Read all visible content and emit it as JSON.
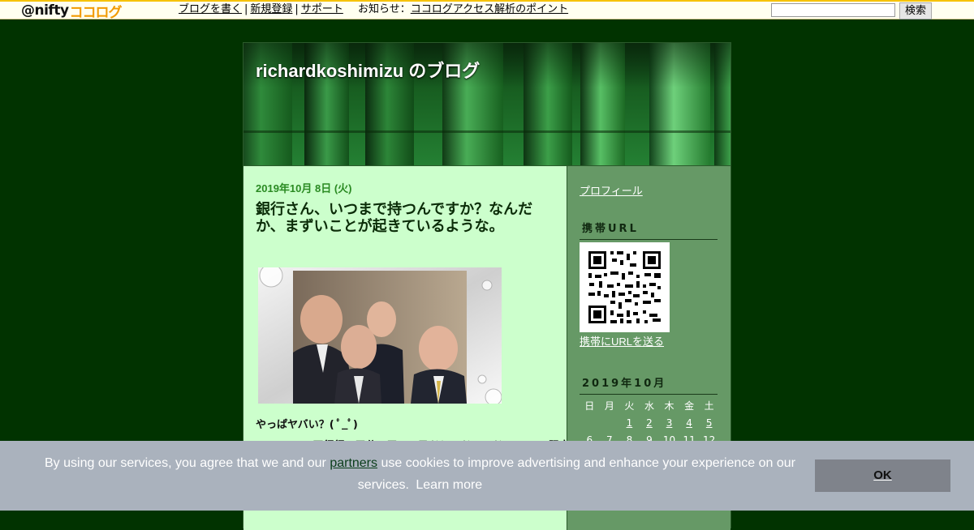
{
  "topbar": {
    "logo_at": "@nifty",
    "logo_kk": "ココログ",
    "links": [
      "ブログを書く",
      "新規登録",
      "サポート"
    ],
    "notice_label": "お知らせ",
    "notice_link": "ココログアクセス解析のポイント",
    "search_placeholder": "",
    "search_button": "検索"
  },
  "blog": {
    "title": "richardkoshimizu のブログ"
  },
  "post": {
    "date": "2019年10月 8日 (火)",
    "title": "銀行さん、いつまで持つんですか？なんだか、まずいことが起きているような。",
    "text1": "やっぱヤバい？( ﾟ_ﾟ)",
    "text2": "…… 四行行、三分二口　ス乙ドレ…ドン…ドロ　…… 阻定"
  },
  "sidebar": {
    "profile_link": "プロフィール",
    "mobile_heading": "携帯URL",
    "send_url_link": "携帯にURLを送る",
    "calendar_heading": "2019年10月",
    "calendar_days": [
      "日",
      "月",
      "火",
      "水",
      "木",
      "金",
      "土"
    ],
    "calendar_week1": [
      "",
      "",
      "1",
      "2",
      "3",
      "4",
      "5"
    ],
    "calendar_week2": [
      "6",
      "7",
      "8",
      "9",
      "10",
      "11",
      "12"
    ]
  },
  "cookie": {
    "text_before": "By using our services, you agree that we and our",
    "partners_link": "partners",
    "text_after": "use cookies to improve advertising and enhance your experience on our services.",
    "learn_more": "Learn more",
    "ok_button": "OK"
  },
  "colors": {
    "page_bg": "#013300",
    "content_bg": "#ccffcc",
    "sidebar_bg": "#669966",
    "date_color": "#2a8a22",
    "cookie_bg": "#aab2bd"
  }
}
